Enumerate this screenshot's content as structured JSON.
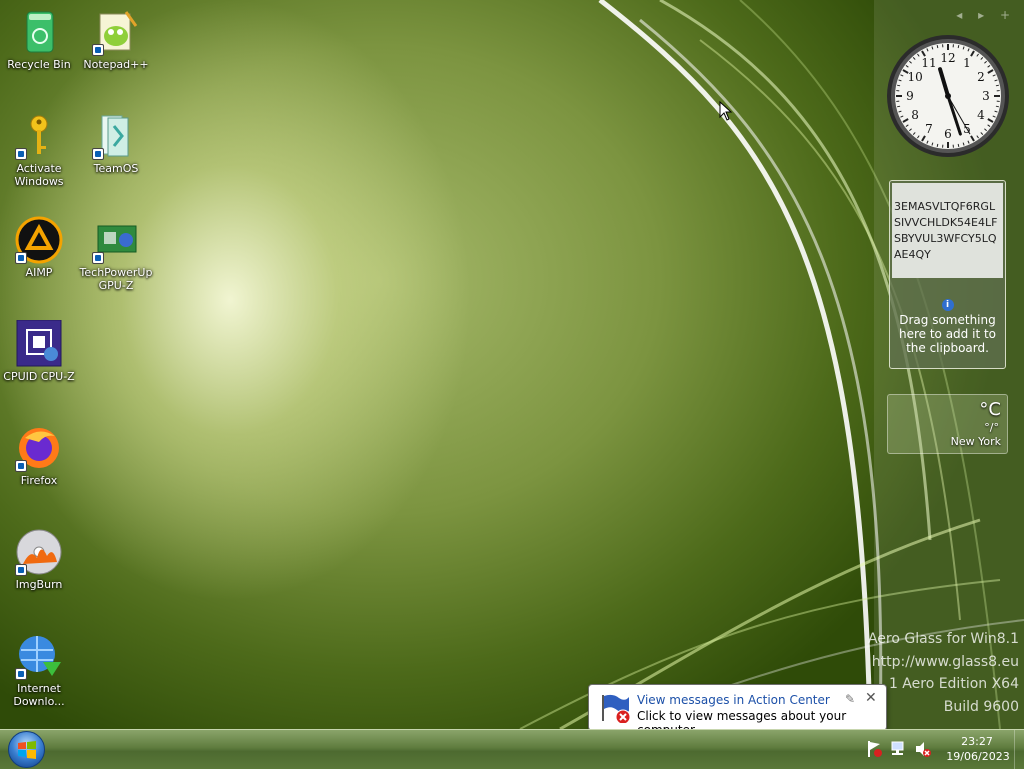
{
  "desktop": {
    "icons": [
      {
        "label": "Recycle Bin",
        "icon": "recycle-bin-icon"
      },
      {
        "label": "Notepad++",
        "icon": "notepad-plus-plus-icon"
      },
      {
        "label": "Activate Windows",
        "icon": "key-icon"
      },
      {
        "label": "TeamOS",
        "icon": "teamos-icon"
      },
      {
        "label": "AIMP",
        "icon": "aimp-icon"
      },
      {
        "label": "TechPowerUp GPU-Z",
        "icon": "gpu-z-icon"
      },
      {
        "label": "CPUID CPU-Z",
        "icon": "cpu-z-icon"
      },
      {
        "label": "Firefox",
        "icon": "firefox-icon"
      },
      {
        "label": "ImgBurn",
        "icon": "imgburn-icon"
      },
      {
        "label": "Internet Downlo...",
        "icon": "internet-download-manager-icon"
      }
    ]
  },
  "sidebar": {
    "nav": "◂ ▸ +",
    "clock_gadget": {
      "hour": 11,
      "minute": 27,
      "second": 25
    },
    "clipboard": {
      "text": "3EMASVLTQF6RGLSIVVCHLDK54E4LFSBYVUL3WFCY5LQAE4QY",
      "info": "Drag something here to add it to the clipboard."
    },
    "weather": {
      "temp": "°C",
      "high_low": "°/°",
      "city": "New York"
    }
  },
  "watermark": {
    "line1": "Aero Glass for Win8.1",
    "line2": "http://www.glass8.eu",
    "line3": "1 Aero Edition X64",
    "line4": "Build 9600"
  },
  "balloon": {
    "title": "View messages in Action Center",
    "body": "Click to view messages about your computer."
  },
  "taskbar": {
    "time": "23:27",
    "date": "19/06/2023"
  }
}
